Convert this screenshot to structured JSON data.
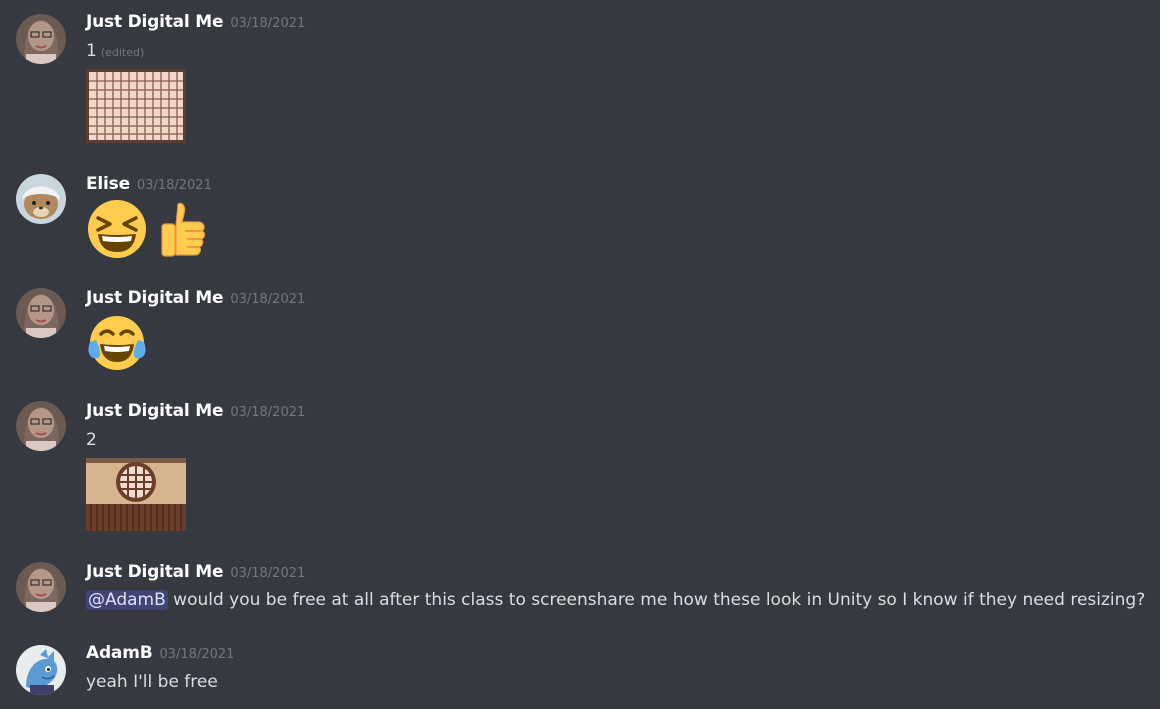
{
  "messages": [
    {
      "username": "Just Digital Me",
      "timestamp": "03/18/2021",
      "text": "1",
      "edited": "(edited)",
      "attachment": "shoji-screen-image"
    },
    {
      "username": "Elise",
      "timestamp": "03/18/2021",
      "emojis": [
        "laughing-emoji",
        "thumbs-up-emoji"
      ]
    },
    {
      "username": "Just Digital Me",
      "timestamp": "03/18/2021",
      "emojis": [
        "tears-of-joy-emoji"
      ]
    },
    {
      "username": "Just Digital Me",
      "timestamp": "03/18/2021",
      "text": "2",
      "attachment": "round-window-wall-image"
    },
    {
      "username": "Just Digital Me",
      "timestamp": "03/18/2021",
      "mention": "@AdamB",
      "text": "would you be free at all after this class to screenshare me how these look in Unity so I know if they need resizing?"
    },
    {
      "username": "AdamB",
      "timestamp": "03/18/2021",
      "text": "yeah I'll be free"
    }
  ],
  "colors": {
    "background": "#36393f",
    "username": "#ffffff",
    "timestamp": "#72767d",
    "message_text": "#dcddde",
    "mention_bg": "#4a4f8a"
  }
}
